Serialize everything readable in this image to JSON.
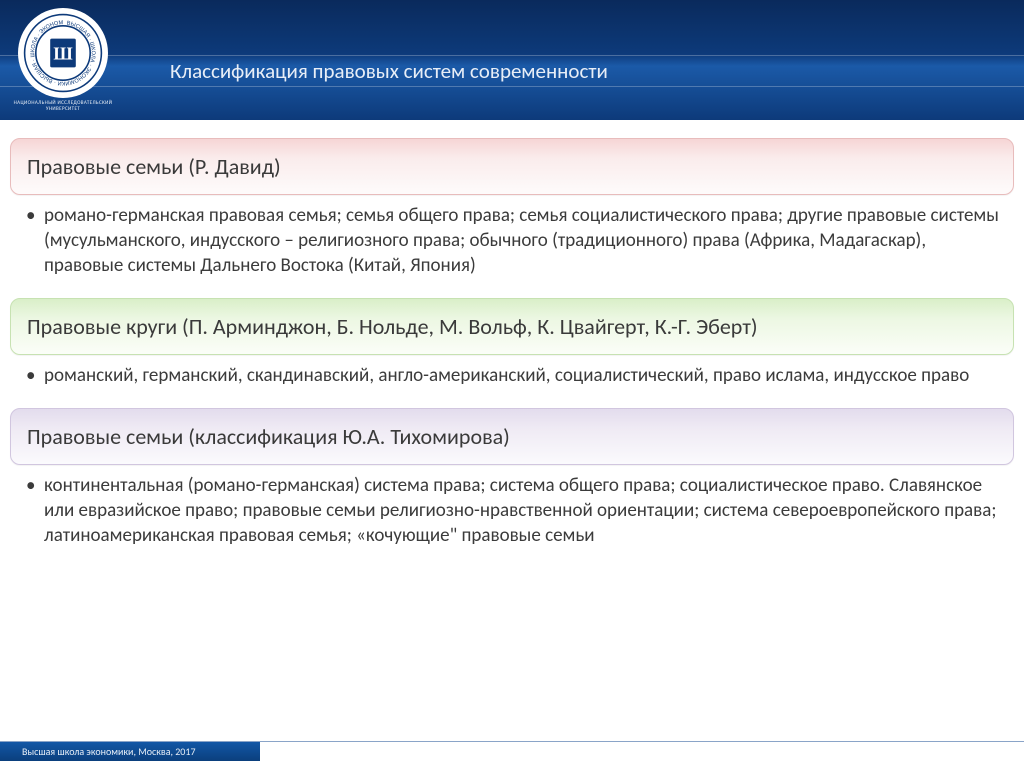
{
  "header": {
    "logo_subtext": "НАЦИОНАЛЬНЫЙ ИССЛЕДОВАТЕЛЬСКИЙ УНИВЕРСИТЕТ",
    "logo_ring": "ВЫСШАЯ · ШКОЛА · ЭКОНОМИКИ",
    "title": "Классификация правовых систем современности"
  },
  "blocks": [
    {
      "color": "red",
      "heading": "Правовые семьи (Р. Давид)",
      "body": "романо-германская правовая семья; семья общего права; семья социалистического права; другие правовые системы (мусульманского, индусского – религиозного права; обычного (традиционного) права (Африка, Мадагаскар), правовые системы Дальнего Востока (Китай, Япония)"
    },
    {
      "color": "green",
      "heading": "Правовые круги (П. Арминджон, Б. Нольде, М. Вольф, К. Цвайгерт, К.-Г. Эберт)",
      "body": "романский, германский, скандинавский, англо-американский, социалистический, право ислама, индусское право"
    },
    {
      "color": "purple",
      "heading": "Правовые семьи (классификация Ю.А. Тихомирова)",
      "body": "континентальная (романо-германская) система права; система общего права; социалистическое право. Славянское или евразийское право; правовые семьи религиозно-нравственной ориентации; система североевропейского права; латиноамериканская правовая семья; «кочующие\" правовые семьи"
    }
  ],
  "footer": {
    "text": "Высшая школа экономики, Москва, 2017"
  },
  "colors": {
    "header_blue": "#0d3a7a",
    "accent_blue": "#1b5aa8"
  }
}
